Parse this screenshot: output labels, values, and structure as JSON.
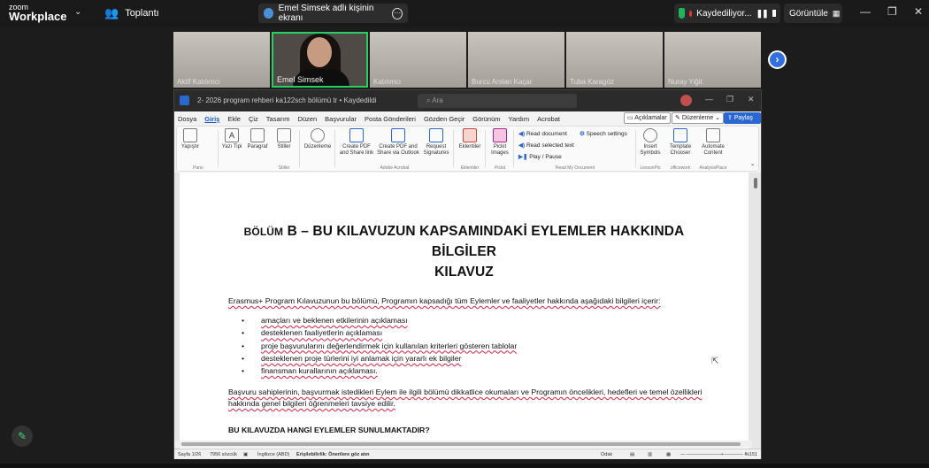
{
  "zoom": {
    "logo_small": "zoom",
    "logo_big": "Workplace",
    "meeting_label": "Toplantı",
    "share_label": "Emel Simsek adlı kişinin ekranı",
    "recording_label": "Kaydediliyor...",
    "view_label": "Görüntüle",
    "window_controls": [
      "—",
      "❐",
      "✕"
    ]
  },
  "gallery": {
    "tiles": [
      {
        "name": "Aktif Katılımcı"
      },
      {
        "name": "Emel Simsek"
      },
      {
        "name": "Katılımcı"
      },
      {
        "name": "Burcu Arslan Kaçar"
      },
      {
        "name": "Tuba Karagöz"
      },
      {
        "name": "Nuray Yiğit"
      }
    ]
  },
  "word": {
    "doc_title": "2- 2026 program rehberi ka122sch bölümü tr • Kaydedildi",
    "search_placeholder": "Ara",
    "menu_tabs": [
      "Dosya",
      "Giriş",
      "Ekle",
      "Çiz",
      "Tasarım",
      "Düzen",
      "Başvurular",
      "Posta Gönderileri",
      "Gözden Geçir",
      "Görünüm",
      "Yardım",
      "Acrobat"
    ],
    "comments_label": "Açıklamalar",
    "editing_label": "Düzenleme",
    "share_label": "Paylaş",
    "ribbon": {
      "paste": "Yapıştır",
      "font": "Yazı Tipi",
      "paragraph": "Paragraf",
      "styles": "Stiller",
      "editing": "Düzenleme",
      "create_pdf_share": "Create PDF and Share link",
      "create_pdf_outlook": "Create PDF and Share via Outlook",
      "request_sign": "Request Signatures",
      "addins": "Eklentiler",
      "pickit": "Pickit Images",
      "read_document": "Read document",
      "read_selected": "Read selected text",
      "play_pause": "Play / Pause",
      "speech_settings": "Speech settings",
      "insert_symbols": "Insert Symbols",
      "template_chooser": "Template Chooser",
      "automate_content": "Automate Content",
      "groups": {
        "pano": "Pano",
        "stiller": "Stiller",
        "adobe": "Adobe Acrobat",
        "eklentiler": "Eklentiler",
        "pickit": "Pickit",
        "readmydoc": "Read My Document",
        "lessonpix": "LessonPix",
        "officework": "officework",
        "analysisplace": "AnalysisPlace"
      }
    },
    "document": {
      "heading_small": "BÖLÜM",
      "heading_line1": "B – BU KILAVUZUN KAPSAMINDAKİ EYLEMLER HAKKINDA",
      "heading_line2": "BİLGİLER",
      "heading_line3": "KILAVUZ",
      "intro": "Erasmus+ Program Kılavuzunun bu bölümü, Programın kapsadığı tüm Eylemler ve faaliyetler hakkında aşağıdaki bilgileri içerir:",
      "bullets": [
        "amaçları ve beklenen etkilerinin açıklaması",
        "desteklenen faaliyetlerin açıklaması",
        "proje başvurularını değerlendirmek için kullanılan kriterleri gösteren tablolar",
        "desteklenen proje türlerini iyi anlamak için yararlı ek bilgiler",
        "finansman kurallarının açıklaması."
      ],
      "paragraph": "Başvuru sahiplerinin, başvurmak istedikleri Eylem ile ilgili bölümü dikkatlice okumaları ve Programın öncelikleri, hedefleri ve temel özellikleri hakkında genel bilgileri öğrenmeleri tavsiye edilir.",
      "subheading": "BU KILAVUZDA HANGİ EYLEMLER SUNULMAKTADIR?"
    },
    "status": {
      "page": "Sayfa 1/26",
      "words": "7956 sözcük",
      "language": "İngilizce (ABD)",
      "accessibility": "Erişilebilirlik: Önerilere göz atın",
      "focus": "Odak",
      "zoom": "%151"
    }
  }
}
